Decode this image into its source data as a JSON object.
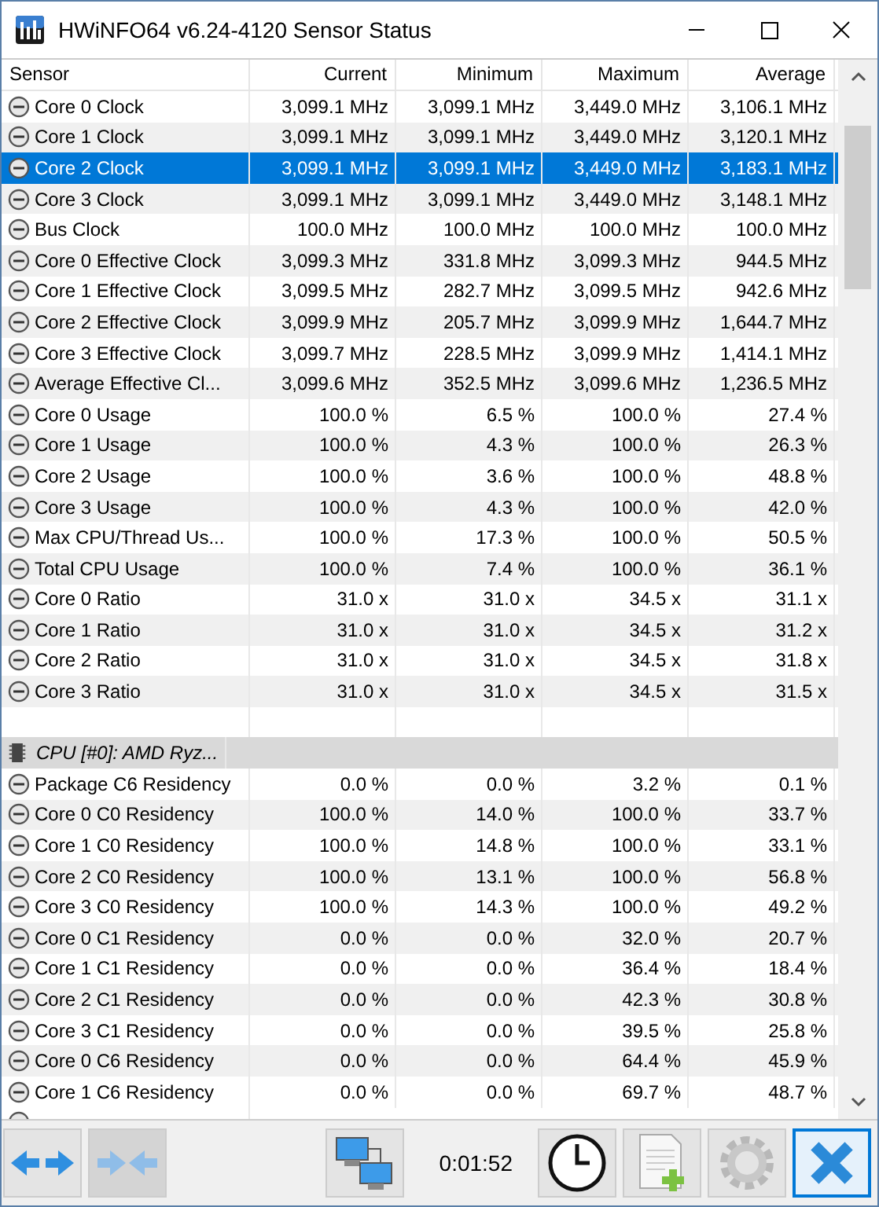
{
  "window": {
    "title": "HWiNFO64 v6.24-4120 Sensor Status"
  },
  "columns": [
    "Sensor",
    "Current",
    "Minimum",
    "Maximum",
    "Average"
  ],
  "rows": [
    {
      "kind": "sensor",
      "label": "Core 0 Clock",
      "values": [
        "3,099.1 MHz",
        "3,099.1 MHz",
        "3,449.0 MHz",
        "3,106.1 MHz"
      ],
      "selected": false
    },
    {
      "kind": "sensor",
      "label": "Core 1 Clock",
      "values": [
        "3,099.1 MHz",
        "3,099.1 MHz",
        "3,449.0 MHz",
        "3,120.1 MHz"
      ],
      "selected": false
    },
    {
      "kind": "sensor",
      "label": "Core 2 Clock",
      "values": [
        "3,099.1 MHz",
        "3,099.1 MHz",
        "3,449.0 MHz",
        "3,183.1 MHz"
      ],
      "selected": true
    },
    {
      "kind": "sensor",
      "label": "Core 3 Clock",
      "values": [
        "3,099.1 MHz",
        "3,099.1 MHz",
        "3,449.0 MHz",
        "3,148.1 MHz"
      ],
      "selected": false
    },
    {
      "kind": "sensor",
      "label": "Bus Clock",
      "values": [
        "100.0 MHz",
        "100.0 MHz",
        "100.0 MHz",
        "100.0 MHz"
      ],
      "selected": false
    },
    {
      "kind": "sensor",
      "label": "Core 0 Effective Clock",
      "values": [
        "3,099.3 MHz",
        "331.8 MHz",
        "3,099.3 MHz",
        "944.5 MHz"
      ],
      "selected": false
    },
    {
      "kind": "sensor",
      "label": "Core 1 Effective Clock",
      "values": [
        "3,099.5 MHz",
        "282.7 MHz",
        "3,099.5 MHz",
        "942.6 MHz"
      ],
      "selected": false
    },
    {
      "kind": "sensor",
      "label": "Core 2 Effective Clock",
      "values": [
        "3,099.9 MHz",
        "205.7 MHz",
        "3,099.9 MHz",
        "1,644.7 MHz"
      ],
      "selected": false
    },
    {
      "kind": "sensor",
      "label": "Core 3 Effective Clock",
      "values": [
        "3,099.7 MHz",
        "228.5 MHz",
        "3,099.9 MHz",
        "1,414.1 MHz"
      ],
      "selected": false
    },
    {
      "kind": "sensor",
      "label": "Average Effective Cl...",
      "values": [
        "3,099.6 MHz",
        "352.5 MHz",
        "3,099.6 MHz",
        "1,236.5 MHz"
      ],
      "selected": false
    },
    {
      "kind": "sensor",
      "label": "Core 0 Usage",
      "values": [
        "100.0 %",
        "6.5 %",
        "100.0 %",
        "27.4 %"
      ],
      "selected": false
    },
    {
      "kind": "sensor",
      "label": "Core 1 Usage",
      "values": [
        "100.0 %",
        "4.3 %",
        "100.0 %",
        "26.3 %"
      ],
      "selected": false
    },
    {
      "kind": "sensor",
      "label": "Core 2 Usage",
      "values": [
        "100.0 %",
        "3.6 %",
        "100.0 %",
        "48.8 %"
      ],
      "selected": false
    },
    {
      "kind": "sensor",
      "label": "Core 3 Usage",
      "values": [
        "100.0 %",
        "4.3 %",
        "100.0 %",
        "42.0 %"
      ],
      "selected": false
    },
    {
      "kind": "sensor",
      "label": "Max CPU/Thread Us...",
      "values": [
        "100.0 %",
        "17.3 %",
        "100.0 %",
        "50.5 %"
      ],
      "selected": false
    },
    {
      "kind": "sensor",
      "label": "Total CPU Usage",
      "values": [
        "100.0 %",
        "7.4 %",
        "100.0 %",
        "36.1 %"
      ],
      "selected": false
    },
    {
      "kind": "sensor",
      "label": "Core 0 Ratio",
      "values": [
        "31.0 x",
        "31.0 x",
        "34.5 x",
        "31.1 x"
      ],
      "selected": false
    },
    {
      "kind": "sensor",
      "label": "Core 1 Ratio",
      "values": [
        "31.0 x",
        "31.0 x",
        "34.5 x",
        "31.2 x"
      ],
      "selected": false
    },
    {
      "kind": "sensor",
      "label": "Core 2 Ratio",
      "values": [
        "31.0 x",
        "31.0 x",
        "34.5 x",
        "31.8 x"
      ],
      "selected": false
    },
    {
      "kind": "sensor",
      "label": "Core 3 Ratio",
      "values": [
        "31.0 x",
        "31.0 x",
        "34.5 x",
        "31.5 x"
      ],
      "selected": false
    },
    {
      "kind": "blank"
    },
    {
      "kind": "group",
      "label": "CPU [#0]: AMD Ryz..."
    },
    {
      "kind": "sensor",
      "label": "Package C6 Residency",
      "values": [
        "0.0 %",
        "0.0 %",
        "3.2 %",
        "0.1 %"
      ],
      "selected": false
    },
    {
      "kind": "sensor",
      "label": "Core 0 C0 Residency",
      "values": [
        "100.0 %",
        "14.0 %",
        "100.0 %",
        "33.7 %"
      ],
      "selected": false
    },
    {
      "kind": "sensor",
      "label": "Core 1 C0 Residency",
      "values": [
        "100.0 %",
        "14.8 %",
        "100.0 %",
        "33.1 %"
      ],
      "selected": false
    },
    {
      "kind": "sensor",
      "label": "Core 2 C0 Residency",
      "values": [
        "100.0 %",
        "13.1 %",
        "100.0 %",
        "56.8 %"
      ],
      "selected": false
    },
    {
      "kind": "sensor",
      "label": "Core 3 C0 Residency",
      "values": [
        "100.0 %",
        "14.3 %",
        "100.0 %",
        "49.2 %"
      ],
      "selected": false
    },
    {
      "kind": "sensor",
      "label": "Core 0 C1 Residency",
      "values": [
        "0.0 %",
        "0.0 %",
        "32.0 %",
        "20.7 %"
      ],
      "selected": false
    },
    {
      "kind": "sensor",
      "label": "Core 1 C1 Residency",
      "values": [
        "0.0 %",
        "0.0 %",
        "36.4 %",
        "18.4 %"
      ],
      "selected": false
    },
    {
      "kind": "sensor",
      "label": "Core 2 C1 Residency",
      "values": [
        "0.0 %",
        "0.0 %",
        "42.3 %",
        "30.8 %"
      ],
      "selected": false
    },
    {
      "kind": "sensor",
      "label": "Core 3 C1 Residency",
      "values": [
        "0.0 %",
        "0.0 %",
        "39.5 %",
        "25.8 %"
      ],
      "selected": false
    },
    {
      "kind": "sensor",
      "label": "Core 0 C6 Residency",
      "values": [
        "0.0 %",
        "0.0 %",
        "64.4 %",
        "45.9 %"
      ],
      "selected": false
    },
    {
      "kind": "sensor",
      "label": "Core 1 C6 Residency",
      "values": [
        "0.0 %",
        "0.0 %",
        "69.7 %",
        "48.7 %"
      ],
      "selected": false
    }
  ],
  "toolbar": {
    "timer": "0:01:52"
  }
}
